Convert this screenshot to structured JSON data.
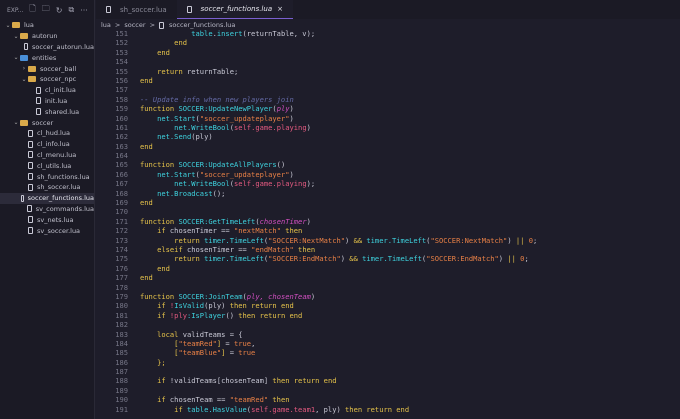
{
  "explorer": {
    "title": "EXP...",
    "toolbar": [
      "new-file-icon",
      "new-folder-icon",
      "refresh-icon",
      "collapse-icon",
      "more-icon"
    ],
    "tree": [
      {
        "label": "lua",
        "type": "folder",
        "depth": 0,
        "open": true
      },
      {
        "label": "autorun",
        "type": "folder",
        "depth": 1,
        "open": true
      },
      {
        "label": "soccer_autorun.lua",
        "type": "file",
        "depth": 2
      },
      {
        "label": "entities",
        "type": "folder-blue",
        "depth": 1,
        "open": true
      },
      {
        "label": "soccer_ball",
        "type": "folder",
        "depth": 2,
        "open": false
      },
      {
        "label": "soccer_npc",
        "type": "folder",
        "depth": 2,
        "open": true
      },
      {
        "label": "cl_init.lua",
        "type": "file",
        "depth": 3
      },
      {
        "label": "init.lua",
        "type": "file",
        "depth": 3
      },
      {
        "label": "shared.lua",
        "type": "file",
        "depth": 3
      },
      {
        "label": "soccer",
        "type": "folder",
        "depth": 1,
        "open": true
      },
      {
        "label": "cl_hud.lua",
        "type": "file",
        "depth": 2
      },
      {
        "label": "cl_info.lua",
        "type": "file",
        "depth": 2
      },
      {
        "label": "cl_menu.lua",
        "type": "file",
        "depth": 2
      },
      {
        "label": "cl_utils.lua",
        "type": "file",
        "depth": 2
      },
      {
        "label": "sh_functions.lua",
        "type": "file",
        "depth": 2
      },
      {
        "label": "sh_soccer.lua",
        "type": "file",
        "depth": 2
      },
      {
        "label": "soccer_functions.lua",
        "type": "file",
        "depth": 2,
        "selected": true
      },
      {
        "label": "sv_commands.lua",
        "type": "file",
        "depth": 2
      },
      {
        "label": "sv_nets.lua",
        "type": "file",
        "depth": 2
      },
      {
        "label": "sv_soccer.lua",
        "type": "file",
        "depth": 2
      }
    ]
  },
  "tabs": [
    {
      "label": "sh_soccer.lua",
      "active": false
    },
    {
      "label": "soccer_functions.lua",
      "active": true,
      "close": "×"
    }
  ],
  "breadcrumb": [
    "lua",
    ">",
    "soccer",
    ">",
    "soccer_functions.lua"
  ],
  "code": {
    "start": 151,
    "lines": [
      [
        [
          "            ",
          "t"
        ],
        [
          "table",
          "f"
        ],
        [
          ".",
          "t"
        ],
        [
          "insert",
          "f"
        ],
        [
          "(returnTable, v);",
          "t"
        ]
      ],
      [
        [
          "        ",
          "t"
        ],
        [
          "end",
          "k"
        ]
      ],
      [
        [
          "    ",
          "t"
        ],
        [
          "end",
          "k"
        ]
      ],
      [],
      [
        [
          "    ",
          "t"
        ],
        [
          "return",
          "k"
        ],
        [
          " returnTable;",
          "t"
        ]
      ],
      [
        [
          "end",
          "k"
        ]
      ],
      [],
      [
        [
          "-- Update info when new players join",
          "c"
        ]
      ],
      [
        [
          "function",
          "k"
        ],
        [
          " SOCCER:UpdateNewPlayer",
          "f"
        ],
        [
          "(",
          "t"
        ],
        [
          "ply",
          "p"
        ],
        [
          ")",
          "t"
        ]
      ],
      [
        [
          "    ",
          "t"
        ],
        [
          "net.Start",
          "f"
        ],
        [
          "(",
          "t"
        ],
        [
          "\"soccer_updateplayer\"",
          "s"
        ],
        [
          ")",
          "t"
        ]
      ],
      [
        [
          "        ",
          "t"
        ],
        [
          "net.WriteBool",
          "f"
        ],
        [
          "(",
          "t"
        ],
        [
          "self.game.playing",
          "v"
        ],
        [
          ")",
          "t"
        ]
      ],
      [
        [
          "    ",
          "t"
        ],
        [
          "net.Send",
          "f"
        ],
        [
          "(ply)",
          "t"
        ]
      ],
      [
        [
          "end",
          "k"
        ]
      ],
      [],
      [
        [
          "function",
          "k"
        ],
        [
          " SOCCER:UpdateAllPlayers",
          "f"
        ],
        [
          "()",
          "t"
        ]
      ],
      [
        [
          "    ",
          "t"
        ],
        [
          "net.Start",
          "f"
        ],
        [
          "(",
          "t"
        ],
        [
          "\"soccer_updateplayer\"",
          "s"
        ],
        [
          ")",
          "t"
        ]
      ],
      [
        [
          "        ",
          "t"
        ],
        [
          "net.WriteBool",
          "f"
        ],
        [
          "(",
          "t"
        ],
        [
          "self.game.playing",
          "v"
        ],
        [
          ");",
          "t"
        ]
      ],
      [
        [
          "    ",
          "t"
        ],
        [
          "net.Broadcast",
          "f"
        ],
        [
          "();",
          "t"
        ]
      ],
      [
        [
          "end",
          "k"
        ]
      ],
      [],
      [
        [
          "function",
          "k"
        ],
        [
          " SOCCER:GetTimeLeft",
          "f"
        ],
        [
          "(",
          "t"
        ],
        [
          "chosenTimer",
          "p"
        ],
        [
          ")",
          "t"
        ]
      ],
      [
        [
          "    ",
          "t"
        ],
        [
          "if",
          "k"
        ],
        [
          " chosenTimer == ",
          "t"
        ],
        [
          "\"nextMatch\"",
          "s"
        ],
        [
          " then",
          "k"
        ]
      ],
      [
        [
          "        ",
          "t"
        ],
        [
          "return",
          "k"
        ],
        [
          " timer.TimeLeft",
          "f"
        ],
        [
          "(",
          "t"
        ],
        [
          "\"SOCCER:NextMatch\"",
          "s"
        ],
        [
          ") ",
          "t"
        ],
        [
          "&&",
          "k"
        ],
        [
          " timer.TimeLeft",
          "f"
        ],
        [
          "(",
          "t"
        ],
        [
          "\"SOCCER:NextMatch\"",
          "s"
        ],
        [
          ") ",
          "t"
        ],
        [
          "||",
          "k"
        ],
        [
          " ",
          "t"
        ],
        [
          "0",
          "n"
        ],
        [
          ";",
          "t"
        ]
      ],
      [
        [
          "    ",
          "t"
        ],
        [
          "elseif",
          "k"
        ],
        [
          " chosenTimer == ",
          "t"
        ],
        [
          "\"endMatch\"",
          "s"
        ],
        [
          " then",
          "k"
        ]
      ],
      [
        [
          "        ",
          "t"
        ],
        [
          "return",
          "k"
        ],
        [
          " timer.TimeLeft",
          "f"
        ],
        [
          "(",
          "t"
        ],
        [
          "\"SOCCER:EndMatch\"",
          "s"
        ],
        [
          ") ",
          "t"
        ],
        [
          "&&",
          "k"
        ],
        [
          " timer.TimeLeft",
          "f"
        ],
        [
          "(",
          "t"
        ],
        [
          "\"SOCCER:EndMatch\"",
          "s"
        ],
        [
          ") ",
          "t"
        ],
        [
          "||",
          "k"
        ],
        [
          " ",
          "t"
        ],
        [
          "0",
          "n"
        ],
        [
          ";",
          "t"
        ]
      ],
      [
        [
          "    ",
          "t"
        ],
        [
          "end",
          "k"
        ]
      ],
      [
        [
          "end",
          "k"
        ]
      ],
      [],
      [
        [
          "function",
          "k"
        ],
        [
          " SOCCER:JoinTeam",
          "f"
        ],
        [
          "(",
          "t"
        ],
        [
          "ply, chosenTeam",
          "p"
        ],
        [
          ")",
          "t"
        ]
      ],
      [
        [
          "    ",
          "t"
        ],
        [
          "if",
          "k"
        ],
        [
          " !",
          "v"
        ],
        [
          "IsValid",
          "f"
        ],
        [
          "(ply) ",
          "t"
        ],
        [
          "then return end",
          "k"
        ]
      ],
      [
        [
          "    ",
          "t"
        ],
        [
          "if",
          "k"
        ],
        [
          " !ply",
          "v"
        ],
        [
          ":IsPlayer",
          "f"
        ],
        [
          "() ",
          "t"
        ],
        [
          "then return end",
          "k"
        ]
      ],
      [],
      [
        [
          "    ",
          "t"
        ],
        [
          "local",
          "k"
        ],
        [
          " validTeams = {",
          "t"
        ]
      ],
      [
        [
          "        [",
          "k"
        ],
        [
          "\"teamRed\"",
          "s"
        ],
        [
          "]",
          "k"
        ],
        [
          " = ",
          "t"
        ],
        [
          "true",
          "s"
        ],
        [
          ",",
          "t"
        ]
      ],
      [
        [
          "        [",
          "k"
        ],
        [
          "\"teamBlue\"",
          "s"
        ],
        [
          "]",
          "k"
        ],
        [
          " = ",
          "t"
        ],
        [
          "true",
          "s"
        ]
      ],
      [
        [
          "    ",
          "t"
        ],
        [
          "};",
          "k"
        ]
      ],
      [],
      [
        [
          "    ",
          "t"
        ],
        [
          "if",
          "k"
        ],
        [
          " !validTeams[chosenTeam] ",
          "t"
        ],
        [
          "then return end",
          "k"
        ]
      ],
      [],
      [
        [
          "    ",
          "t"
        ],
        [
          "if",
          "k"
        ],
        [
          " chosenTeam == ",
          "t"
        ],
        [
          "\"teamRed\"",
          "s"
        ],
        [
          " then",
          "k"
        ]
      ],
      [
        [
          "        ",
          "t"
        ],
        [
          "if",
          "k"
        ],
        [
          " table.HasValue",
          "f"
        ],
        [
          "(",
          "t"
        ],
        [
          "self.game.team1",
          "v"
        ],
        [
          ", ply) ",
          "t"
        ],
        [
          "then return end",
          "k"
        ]
      ]
    ]
  }
}
